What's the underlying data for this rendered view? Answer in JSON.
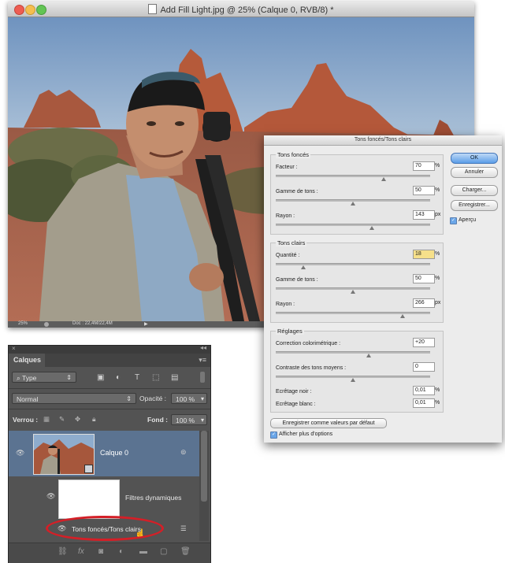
{
  "document_window": {
    "title": "Add Fill Light.jpg @ 25% (Calque 0, RVB/8) *",
    "status_zoom": "25%",
    "status_doc": "Doc : 22,4M/22,4M"
  },
  "dialog": {
    "title": "Tons foncés/Tons clairs",
    "shadows": {
      "title": "Tons foncés",
      "amount_label": "Facteur :",
      "amount_value": "70",
      "amount_unit": "%",
      "tonal_label": "Gamme de tons :",
      "tonal_value": "50",
      "tonal_unit": "%",
      "radius_label": "Rayon :",
      "radius_value": "143",
      "radius_unit": "px"
    },
    "highlights": {
      "title": "Tons clairs",
      "amount_label": "Quantité :",
      "amount_value": "18",
      "amount_unit": "%",
      "tonal_label": "Gamme de tons :",
      "tonal_value": "50",
      "tonal_unit": "%",
      "radius_label": "Rayon :",
      "radius_value": "266",
      "radius_unit": "px"
    },
    "adjustments": {
      "title": "Réglages",
      "color_label": "Correction colorimétrique :",
      "color_value": "+20",
      "midtone_label": "Contraste des tons moyens :",
      "midtone_value": "0",
      "black_label": "Ecrêtage noir :",
      "black_value": "0,01",
      "black_unit": "%",
      "white_label": "Ecrêtage blanc :",
      "white_value": "0,01",
      "white_unit": "%"
    },
    "slider_levels": {
      "shadows_amount": 0.7,
      "shadows_tonal": 0.5,
      "shadows_radius": 0.62,
      "highlights_amount": 0.18,
      "highlights_tonal": 0.5,
      "highlights_radius": 0.82,
      "color": 0.6,
      "midtone": 0.5
    },
    "buttons": {
      "ok": "OK",
      "cancel": "Annuler",
      "load": "Charger...",
      "save": "Enregistrer...",
      "preview": "Aperçu",
      "save_defaults": "Enregistrer comme valeurs par défaut",
      "more_options": "Afficher plus d'options"
    }
  },
  "layers_panel": {
    "tab": "Calques",
    "filter_kind": "Type",
    "blend_mode": "Normal",
    "opacity_label": "Opacité :",
    "opacity_value": "100 %",
    "lock_label": "Verrou :",
    "fill_label": "Fond :",
    "fill_value": "100 %",
    "layer_name": "Calque 0",
    "smart_filters_label": "Filtres dynamiques",
    "filter_name": "Tons foncés/Tons clairs"
  },
  "colors": {
    "annotation_oval": "#d41f27",
    "selected_layer": "#5b7391"
  }
}
